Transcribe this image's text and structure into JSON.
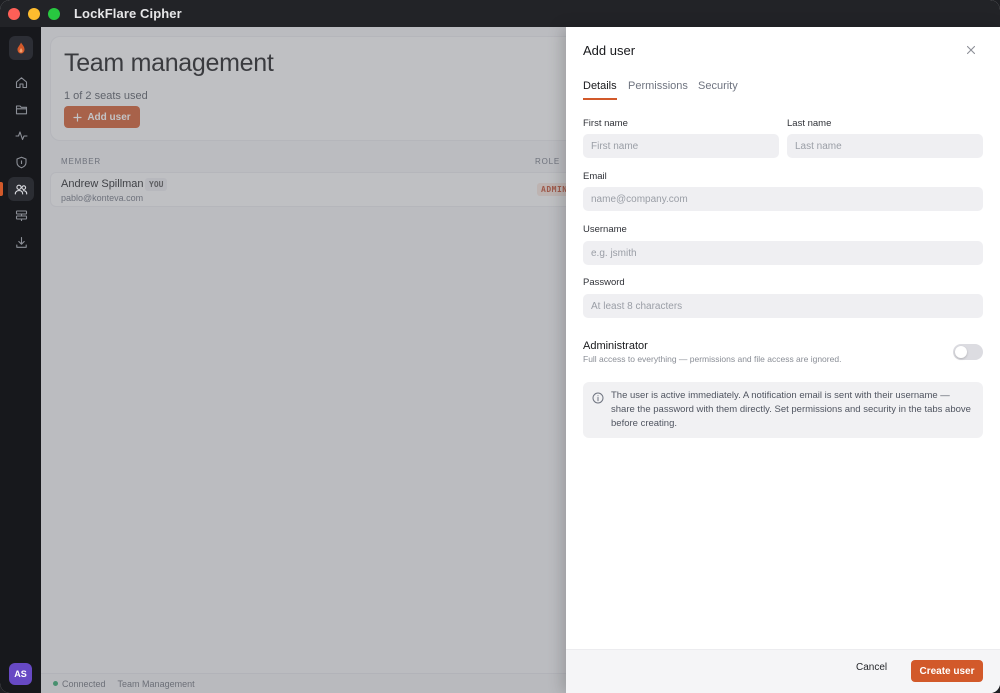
{
  "app": {
    "title": "LockFlare Cipher"
  },
  "sidebar": {
    "icons": [
      "home-icon",
      "folder-icon",
      "activity-icon",
      "shield-icon",
      "users-icon",
      "servers-icon",
      "download-icon"
    ],
    "active": "users-icon",
    "avatar_initials": "AS"
  },
  "main": {
    "title": "Team management",
    "subtitle": "1 of 2 seats used",
    "add_button": "Add user",
    "table": {
      "columns": [
        "MEMBER",
        "ROLE"
      ],
      "rows": [
        {
          "name": "Andrew Spillman",
          "badge": "YOU",
          "email": "pablo@konteva.com",
          "role": "ADMIN"
        }
      ]
    }
  },
  "statusbar": {
    "connection": "Connected",
    "section": "Team Management"
  },
  "drawer": {
    "title": "Add user",
    "tabs": [
      {
        "label": "Details",
        "active": true
      },
      {
        "label": "Permissions",
        "active": false
      },
      {
        "label": "Security",
        "active": false
      }
    ],
    "fields": {
      "first_name": {
        "label": "First name",
        "placeholder": "First name",
        "value": ""
      },
      "last_name": {
        "label": "Last name",
        "placeholder": "Last name",
        "value": ""
      },
      "email": {
        "label": "Email",
        "placeholder": "name@company.com",
        "value": ""
      },
      "username": {
        "label": "Username",
        "placeholder": "e.g. jsmith",
        "value": ""
      },
      "password": {
        "label": "Password",
        "placeholder": "At least 8 characters",
        "value": ""
      }
    },
    "administrator": {
      "title": "Administrator",
      "description": "Full access to everything — permissions and file access are ignored.",
      "enabled": false
    },
    "info": "The user is active immediately. A notification email is sent with their username — share the password with them directly. Set permissions and security in the tabs above before creating.",
    "cancel": "Cancel",
    "create": "Create user"
  },
  "colors": {
    "accent": "#d2592a",
    "sidebar_bg": "#17181c",
    "avatar_bg": "#6749c4",
    "status_online": "#2ea86a"
  }
}
